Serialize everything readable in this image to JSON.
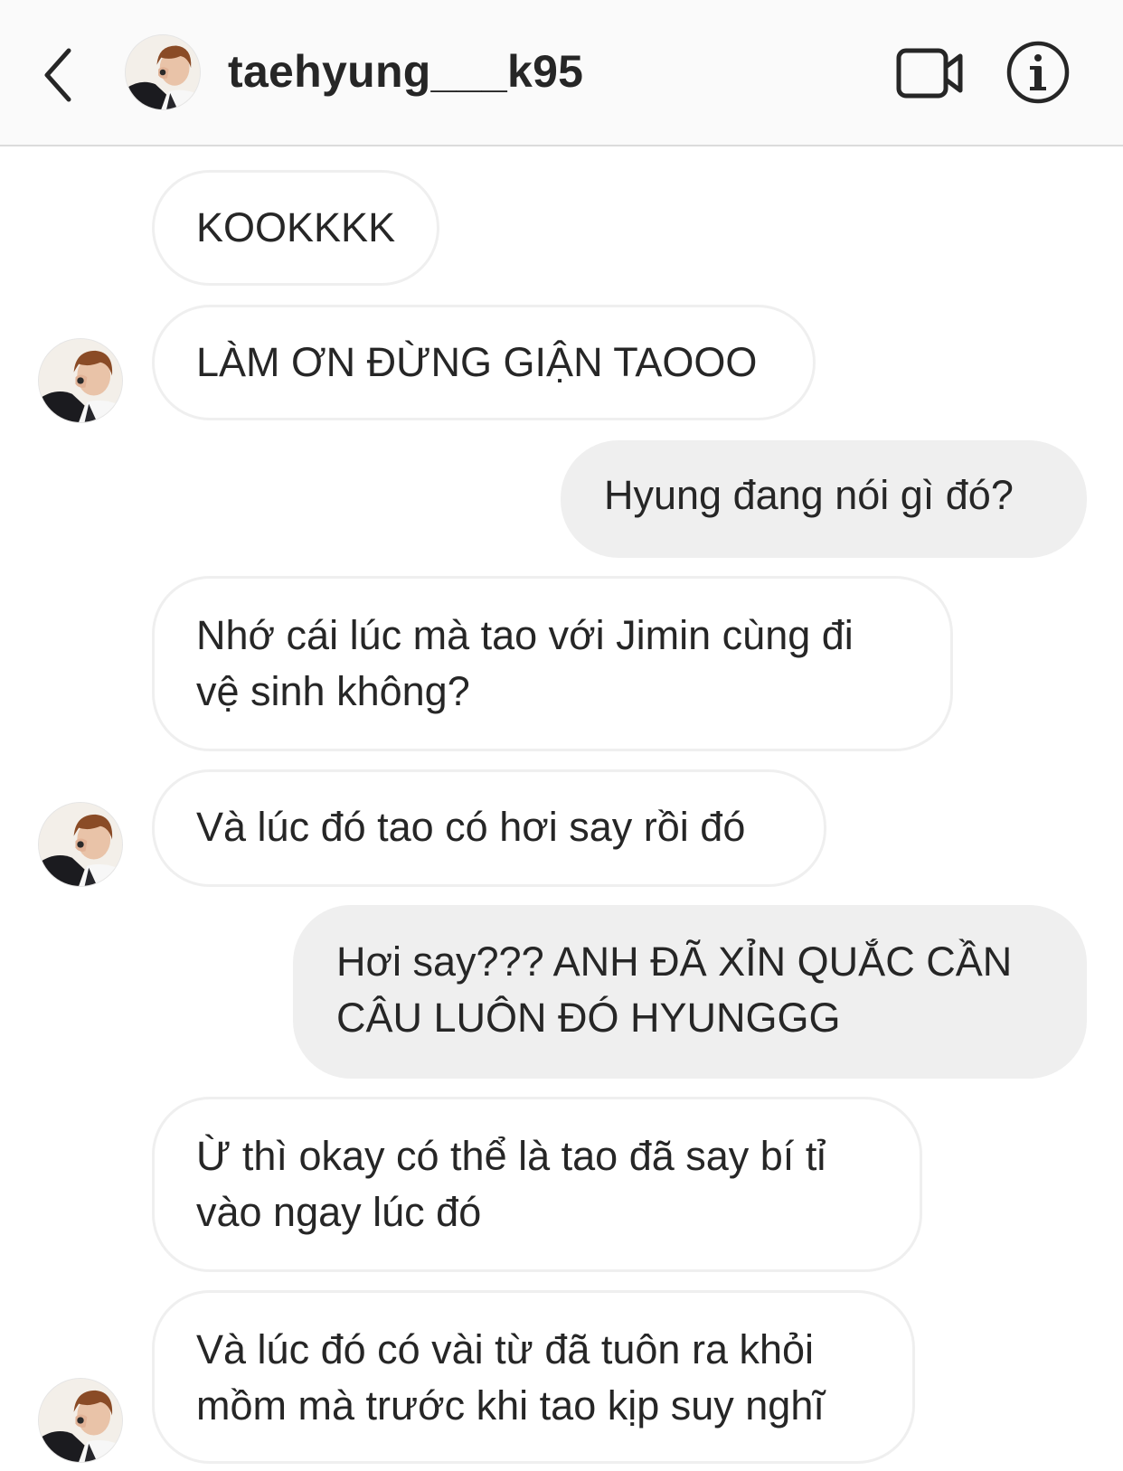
{
  "header": {
    "username": "taehyung___k95",
    "icons": [
      "back-chevron-icon",
      "profile-avatar",
      "video-call-icon",
      "info-icon"
    ]
  },
  "messages": [
    {
      "direction": "incoming",
      "lines": [
        "KOOKKKK"
      ]
    },
    {
      "direction": "incoming",
      "lines": [
        "LÀM ƠN ĐỪNG GIẬN TAOOO"
      ]
    },
    {
      "direction": "outgoing",
      "lines": [
        "Hyung đang nói gì đó?"
      ]
    },
    {
      "direction": "incoming",
      "lines": [
        "Nhớ cái lúc mà tao với Jimin cùng đi",
        "vệ sinh không?"
      ]
    },
    {
      "direction": "incoming",
      "lines": [
        "Và lúc đó tao có hơi say rồi đó"
      ]
    },
    {
      "direction": "outgoing",
      "lines": [
        "Hơi say??? ANH ĐÃ XỈN QUẮC CẦN",
        "CÂU LUÔN ĐÓ HYUNGGG"
      ]
    },
    {
      "direction": "incoming",
      "lines": [
        "Ừ thì okay có thể là tao đã say bí tỉ",
        "vào ngay lúc đó"
      ]
    },
    {
      "direction": "incoming",
      "lines": [
        "Và lúc đó có vài từ đã tuôn ra khỏi",
        "mồm mà trước khi tao kịp suy nghĩ"
      ]
    }
  ],
  "colors": {
    "header_bg": "#fafafa",
    "incoming_border": "#efefef",
    "outgoing_bg": "#efefef",
    "text": "#262626"
  }
}
